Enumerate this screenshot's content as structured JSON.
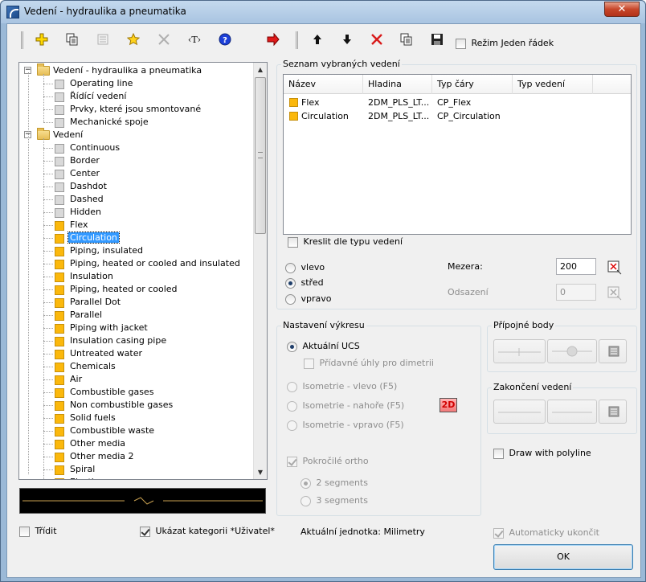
{
  "window": {
    "title": "Vedení - hydraulika a pneumatika",
    "close_glyph": "✕"
  },
  "toolbar": {
    "mode_label": "Režim Jeden řádek",
    "text_tool_glyph": "‹T›"
  },
  "tree": {
    "groups": [
      {
        "label": "Vedení - hydraulika a pneumatika",
        "items": [
          {
            "label": "Operating line",
            "swatch": "grey"
          },
          {
            "label": "Řídící vedení",
            "swatch": "grey"
          },
          {
            "label": "Prvky, které jsou smontované",
            "swatch": "grey"
          },
          {
            "label": "Mechanické spoje",
            "swatch": "grey"
          }
        ]
      },
      {
        "label": "Vedení",
        "items": [
          {
            "label": "Continuous",
            "swatch": "grey"
          },
          {
            "label": "Border",
            "swatch": "grey"
          },
          {
            "label": "Center",
            "swatch": "grey"
          },
          {
            "label": "Dashdot",
            "swatch": "grey"
          },
          {
            "label": "Dashed",
            "swatch": "grey"
          },
          {
            "label": "Hidden",
            "swatch": "grey"
          },
          {
            "label": "Flex",
            "swatch": "yellow"
          },
          {
            "label": "Circulation",
            "swatch": "yellow",
            "selected": true
          },
          {
            "label": "Piping, insulated",
            "swatch": "yellow"
          },
          {
            "label": "Piping, heated or cooled and insulated",
            "swatch": "yellow"
          },
          {
            "label": "Insulation",
            "swatch": "yellow"
          },
          {
            "label": "Piping, heated or cooled",
            "swatch": "yellow"
          },
          {
            "label": "Parallel Dot",
            "swatch": "yellow"
          },
          {
            "label": "Parallel",
            "swatch": "yellow"
          },
          {
            "label": "Piping with jacket",
            "swatch": "yellow"
          },
          {
            "label": "Insulation casing pipe",
            "swatch": "yellow"
          },
          {
            "label": "Untreated water",
            "swatch": "yellow"
          },
          {
            "label": "Chemicals",
            "swatch": "yellow"
          },
          {
            "label": "Air",
            "swatch": "yellow"
          },
          {
            "label": "Combustible gases",
            "swatch": "yellow"
          },
          {
            "label": "Non combustible gases",
            "swatch": "yellow"
          },
          {
            "label": "Solid fuels",
            "swatch": "yellow"
          },
          {
            "label": "Combustible waste",
            "swatch": "yellow"
          },
          {
            "label": "Other media",
            "swatch": "yellow"
          },
          {
            "label": "Other media 2",
            "swatch": "yellow"
          },
          {
            "label": "Spiral",
            "swatch": "yellow"
          },
          {
            "label": "Elastic",
            "swatch": "yellow"
          }
        ]
      }
    ]
  },
  "selected_list": {
    "title": "Seznam vybraných vedení",
    "columns": [
      "Název",
      "Hladina",
      "Typ čáry",
      "Typ vedení"
    ],
    "rows": [
      {
        "name": "Flex",
        "layer": "2DM_PLS_LT...",
        "linetype": "CP_Flex",
        "type": ""
      },
      {
        "name": "Circulation",
        "layer": "2DM_PLS_LT...",
        "linetype": "CP_Circulation",
        "type": ""
      }
    ],
    "draw_by_type_label": "Kreslit dle typu vedení",
    "align": {
      "left": "vlevo",
      "center": "střed",
      "right": "vpravo"
    },
    "gap_label": "Mezera:",
    "gap_value": "200",
    "offset_label": "Odsazení",
    "offset_value": "0"
  },
  "drawing_settings": {
    "title": "Nastavení výkresu",
    "current_ucs": "Aktuální UCS",
    "dimetric": "Přídavné úhly pro dimetrii",
    "iso_left": "Isometrie - vlevo (F5)",
    "iso_top": "Isometrie - nahoře (F5)",
    "iso_right": "Isometrie - vpravo (F5)",
    "badge": "2D",
    "advanced_ortho": "Pokročilé ortho",
    "seg2": "2 segments",
    "seg3": "3 segments"
  },
  "connection_points": {
    "title": "Přípojné body"
  },
  "line_ending": {
    "title": "Zakončení vedení"
  },
  "draw_polyline": "Draw with polyline",
  "footer": {
    "sort_label": "Třídit",
    "show_category_label": "Ukázat kategorii *Uživatel*",
    "unit_label": "Aktuální jednotka: Milimetry",
    "auto_finish_label": "Automaticky ukončit",
    "ok_label": "OK"
  },
  "colors": {
    "selection": "#3399ff",
    "swatch_yellow": "#fbb80c",
    "preview_line": "#c8a050"
  }
}
